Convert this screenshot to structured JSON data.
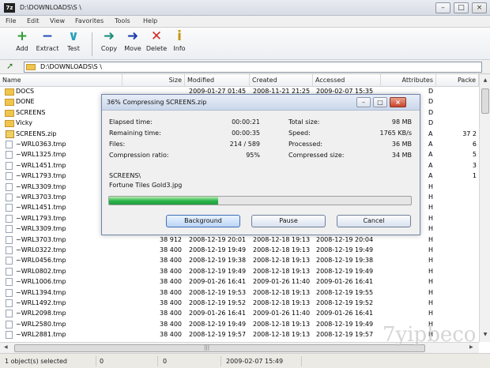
{
  "window": {
    "title": "D:\\DOWNLOADS\\S \\",
    "min": "–",
    "max": "□",
    "close": "×"
  },
  "menu": [
    "File",
    "Edit",
    "View",
    "Favorites",
    "Tools",
    "Help"
  ],
  "toolbar": [
    {
      "label": "Add",
      "icon": "+",
      "color": "#2d9d34"
    },
    {
      "label": "Extract",
      "icon": "−",
      "color": "#2049b9"
    },
    {
      "label": "Test",
      "icon": "∨",
      "color": "#27a0b8"
    },
    {
      "label": "Copy",
      "icon": "➜",
      "color": "#1d8f7c"
    },
    {
      "label": "Move",
      "icon": "➜",
      "color": "#1d3fa8"
    },
    {
      "label": "Delete",
      "icon": "✕",
      "color": "#d12b22"
    },
    {
      "label": "Info",
      "icon": "i",
      "color": "#c79510"
    }
  ],
  "address": {
    "path": "D:\\DOWNLOADS\\S \\"
  },
  "columns": {
    "name": "Name",
    "size": "Size",
    "modified": "Modified",
    "created": "Created",
    "accessed": "Accessed",
    "attributes": "Attributes",
    "packed": "Packe"
  },
  "files": [
    {
      "name": "DOCS",
      "type": "folder",
      "size": "",
      "modified": "2009-01-27 01:45",
      "created": "2008-11-21 21:25",
      "accessed": "2009-02-07 15:35",
      "attr": "D",
      "packed": ""
    },
    {
      "name": "DONE",
      "type": "folder",
      "size": "",
      "modified": "",
      "created": "",
      "accessed": "",
      "attr": "D",
      "packed": ""
    },
    {
      "name": "SCREENS",
      "type": "folder",
      "size": "",
      "modified": "",
      "created": "",
      "accessed": "",
      "attr": "D",
      "packed": ""
    },
    {
      "name": "Vicky",
      "type": "folder",
      "size": "",
      "modified": "",
      "created": "",
      "accessed": "",
      "attr": "D",
      "packed": ""
    },
    {
      "name": "SCREENS.zip",
      "type": "zip",
      "size": "",
      "modified": "",
      "created": "",
      "accessed": "",
      "attr": "A",
      "packed": "37 2"
    },
    {
      "name": "~WRL0363.tmp",
      "type": "file",
      "size": "",
      "modified": "",
      "created": "",
      "accessed": "",
      "attr": "A",
      "packed": "6"
    },
    {
      "name": "~WRL1325.tmp",
      "type": "file",
      "size": "",
      "modified": "",
      "created": "",
      "accessed": "",
      "attr": "A",
      "packed": "5"
    },
    {
      "name": "~WRL1451.tmp",
      "type": "file",
      "size": "",
      "modified": "",
      "created": "",
      "accessed": "",
      "attr": "A",
      "packed": "3"
    },
    {
      "name": "~WRL1793.tmp",
      "type": "file",
      "size": "",
      "modified": "",
      "created": "",
      "accessed": "",
      "attr": "A",
      "packed": "1"
    },
    {
      "name": "~WRL3309.tmp",
      "type": "file",
      "size": "",
      "modified": "",
      "created": "",
      "accessed": "",
      "attr": "H",
      "packed": ""
    },
    {
      "name": "~WRL3703.tmp",
      "type": "file",
      "size": "",
      "modified": "",
      "created": "",
      "accessed": "",
      "attr": "H",
      "packed": ""
    },
    {
      "name": "~WRL1451.tmp",
      "type": "file",
      "size": "",
      "modified": "",
      "created": "",
      "accessed": "",
      "attr": "H",
      "packed": ""
    },
    {
      "name": "~WRL1793.tmp",
      "type": "file",
      "size": "",
      "modified": "",
      "created": "",
      "accessed": "",
      "attr": "H",
      "packed": ""
    },
    {
      "name": "~WRL3309.tmp",
      "type": "file",
      "size": "",
      "modified": "",
      "created": "",
      "accessed": "",
      "attr": "H",
      "packed": ""
    },
    {
      "name": "~WRL3703.tmp",
      "type": "file",
      "size": "38 912",
      "modified": "2008-12-19 20:01",
      "created": "2008-12-18 19:13",
      "accessed": "2008-12-19 20:04",
      "attr": "H",
      "packed": ""
    },
    {
      "name": "~WRL0322.tmp",
      "type": "file",
      "size": "38 400",
      "modified": "2008-12-19 19:49",
      "created": "2008-12-18 19:13",
      "accessed": "2008-12-19 19:49",
      "attr": "H",
      "packed": ""
    },
    {
      "name": "~WRL0456.tmp",
      "type": "file",
      "size": "38 400",
      "modified": "2008-12-19 19:38",
      "created": "2008-12-18 19:13",
      "accessed": "2008-12-19 19:38",
      "attr": "H",
      "packed": ""
    },
    {
      "name": "~WRL0802.tmp",
      "type": "file",
      "size": "38 400",
      "modified": "2008-12-19 19:49",
      "created": "2008-12-18 19:13",
      "accessed": "2008-12-19 19:49",
      "attr": "H",
      "packed": ""
    },
    {
      "name": "~WRL1006.tmp",
      "type": "file",
      "size": "38 400",
      "modified": "2009-01-26 16:41",
      "created": "2009-01-26 11:40",
      "accessed": "2009-01-26 16:41",
      "attr": "H",
      "packed": ""
    },
    {
      "name": "~WRL1394.tmp",
      "type": "file",
      "size": "38 400",
      "modified": "2008-12-19 19:53",
      "created": "2008-12-18 19:13",
      "accessed": "2008-12-19 19:55",
      "attr": "H",
      "packed": ""
    },
    {
      "name": "~WRL1492.tmp",
      "type": "file",
      "size": "38 400",
      "modified": "2008-12-19 19:52",
      "created": "2008-12-18 19:13",
      "accessed": "2008-12-19 19:52",
      "attr": "H",
      "packed": ""
    },
    {
      "name": "~WRL2098.tmp",
      "type": "file",
      "size": "38 400",
      "modified": "2009-01-26 16:41",
      "created": "2009-01-26 11:40",
      "accessed": "2009-01-26 16:41",
      "attr": "H",
      "packed": ""
    },
    {
      "name": "~WRL2580.tmp",
      "type": "file",
      "size": "38 400",
      "modified": "2008-12-19 19:49",
      "created": "2008-12-18 19:13",
      "accessed": "2008-12-19 19:49",
      "attr": "H",
      "packed": ""
    },
    {
      "name": "~WRL2881.tmp",
      "type": "file",
      "size": "38 400",
      "modified": "2008-12-19 19:57",
      "created": "2008-12-18 19:13",
      "accessed": "2008-12-19 19:57",
      "attr": "H",
      "packed": ""
    }
  ],
  "status": {
    "selected": "1 object(s) selected",
    "size": "0",
    "packed": "0",
    "modified": "2009-02-07 15:49"
  },
  "watermark": "7yipbeco",
  "dialog": {
    "title": "36% Compressing SCREENS.zip",
    "elapsed_label": "Elapsed time:",
    "elapsed_value": "00:00:21",
    "remaining_label": "Remaining time:",
    "remaining_value": "00:00:35",
    "files_label": "Files:",
    "files_value": "214 / 589",
    "ratio_label": "Compression ratio:",
    "ratio_value": "95%",
    "total_label": "Total size:",
    "total_value": "98 MB",
    "speed_label": "Speed:",
    "speed_value": "1765 KB/s",
    "processed_label": "Processed:",
    "processed_value": "36 MB",
    "compressed_label": "Compressed size:",
    "compressed_value": "34 MB",
    "folder_line": "SCREENS\\",
    "file_line": "Fortune Tiles Gold3.jpg",
    "progress_percent": 36,
    "background_btn": "Background",
    "pause_btn": "Pause",
    "cancel_btn": "Cancel",
    "min": "–",
    "max": "□",
    "close": "×"
  },
  "colors": {
    "folder": "#efc64d",
    "progress": "#2bb24a",
    "dialog_border": "#6d86a8"
  }
}
